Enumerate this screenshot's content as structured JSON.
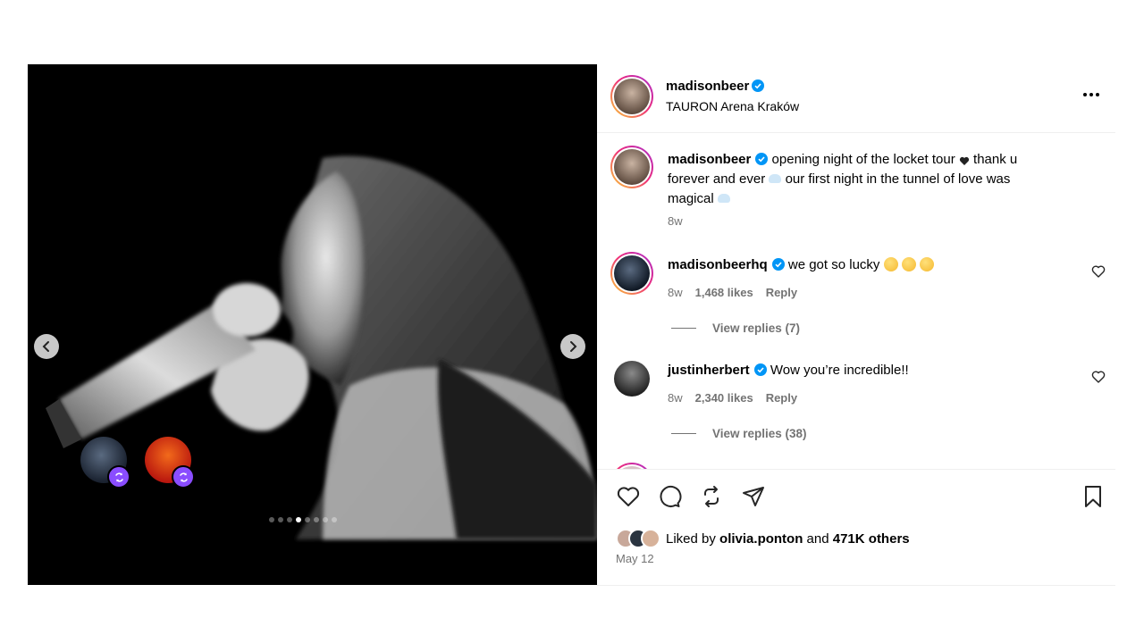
{
  "post": {
    "author": "madisonbeer",
    "location": "TAURON Arena Kraków",
    "carousel": {
      "total": 8,
      "active_index": 4
    }
  },
  "caption": {
    "username": "madisonbeer",
    "text_1": "opening night of the locket tour",
    "text_2": "thank u forever and ever",
    "text_3": "our first night in the tunnel of love was magical",
    "age": "8w"
  },
  "comments": [
    {
      "username": "madisonbeerhq",
      "text": "we got so lucky",
      "age": "8w",
      "likes": "1,468 likes",
      "reply_label": "Reply",
      "view_replies": "View replies (7)"
    },
    {
      "username": "justinherbert",
      "text": "Wow you’re incredible!!",
      "age": "8w",
      "likes": "2,340 likes",
      "reply_label": "Reply",
      "view_replies": "View replies (38)"
    }
  ],
  "likes": {
    "prefix": "Liked by",
    "first_user": "olivia.ponton",
    "and": "and",
    "others": "471K others"
  },
  "date": "May 12",
  "icons": {
    "like": "heart-icon",
    "comment": "comment-icon",
    "repost": "repost-icon",
    "share": "share-icon",
    "save": "bookmark-icon",
    "more": "more-icon",
    "verified": "verified-badge-icon"
  },
  "colors": {
    "verified": "#0095f6",
    "story_ring_start": "#f9ce34",
    "story_ring_mid": "#ee2a7b",
    "story_ring_end": "#a62fd1",
    "collab_badge": "#8a4dff",
    "muted_text": "#737373"
  }
}
